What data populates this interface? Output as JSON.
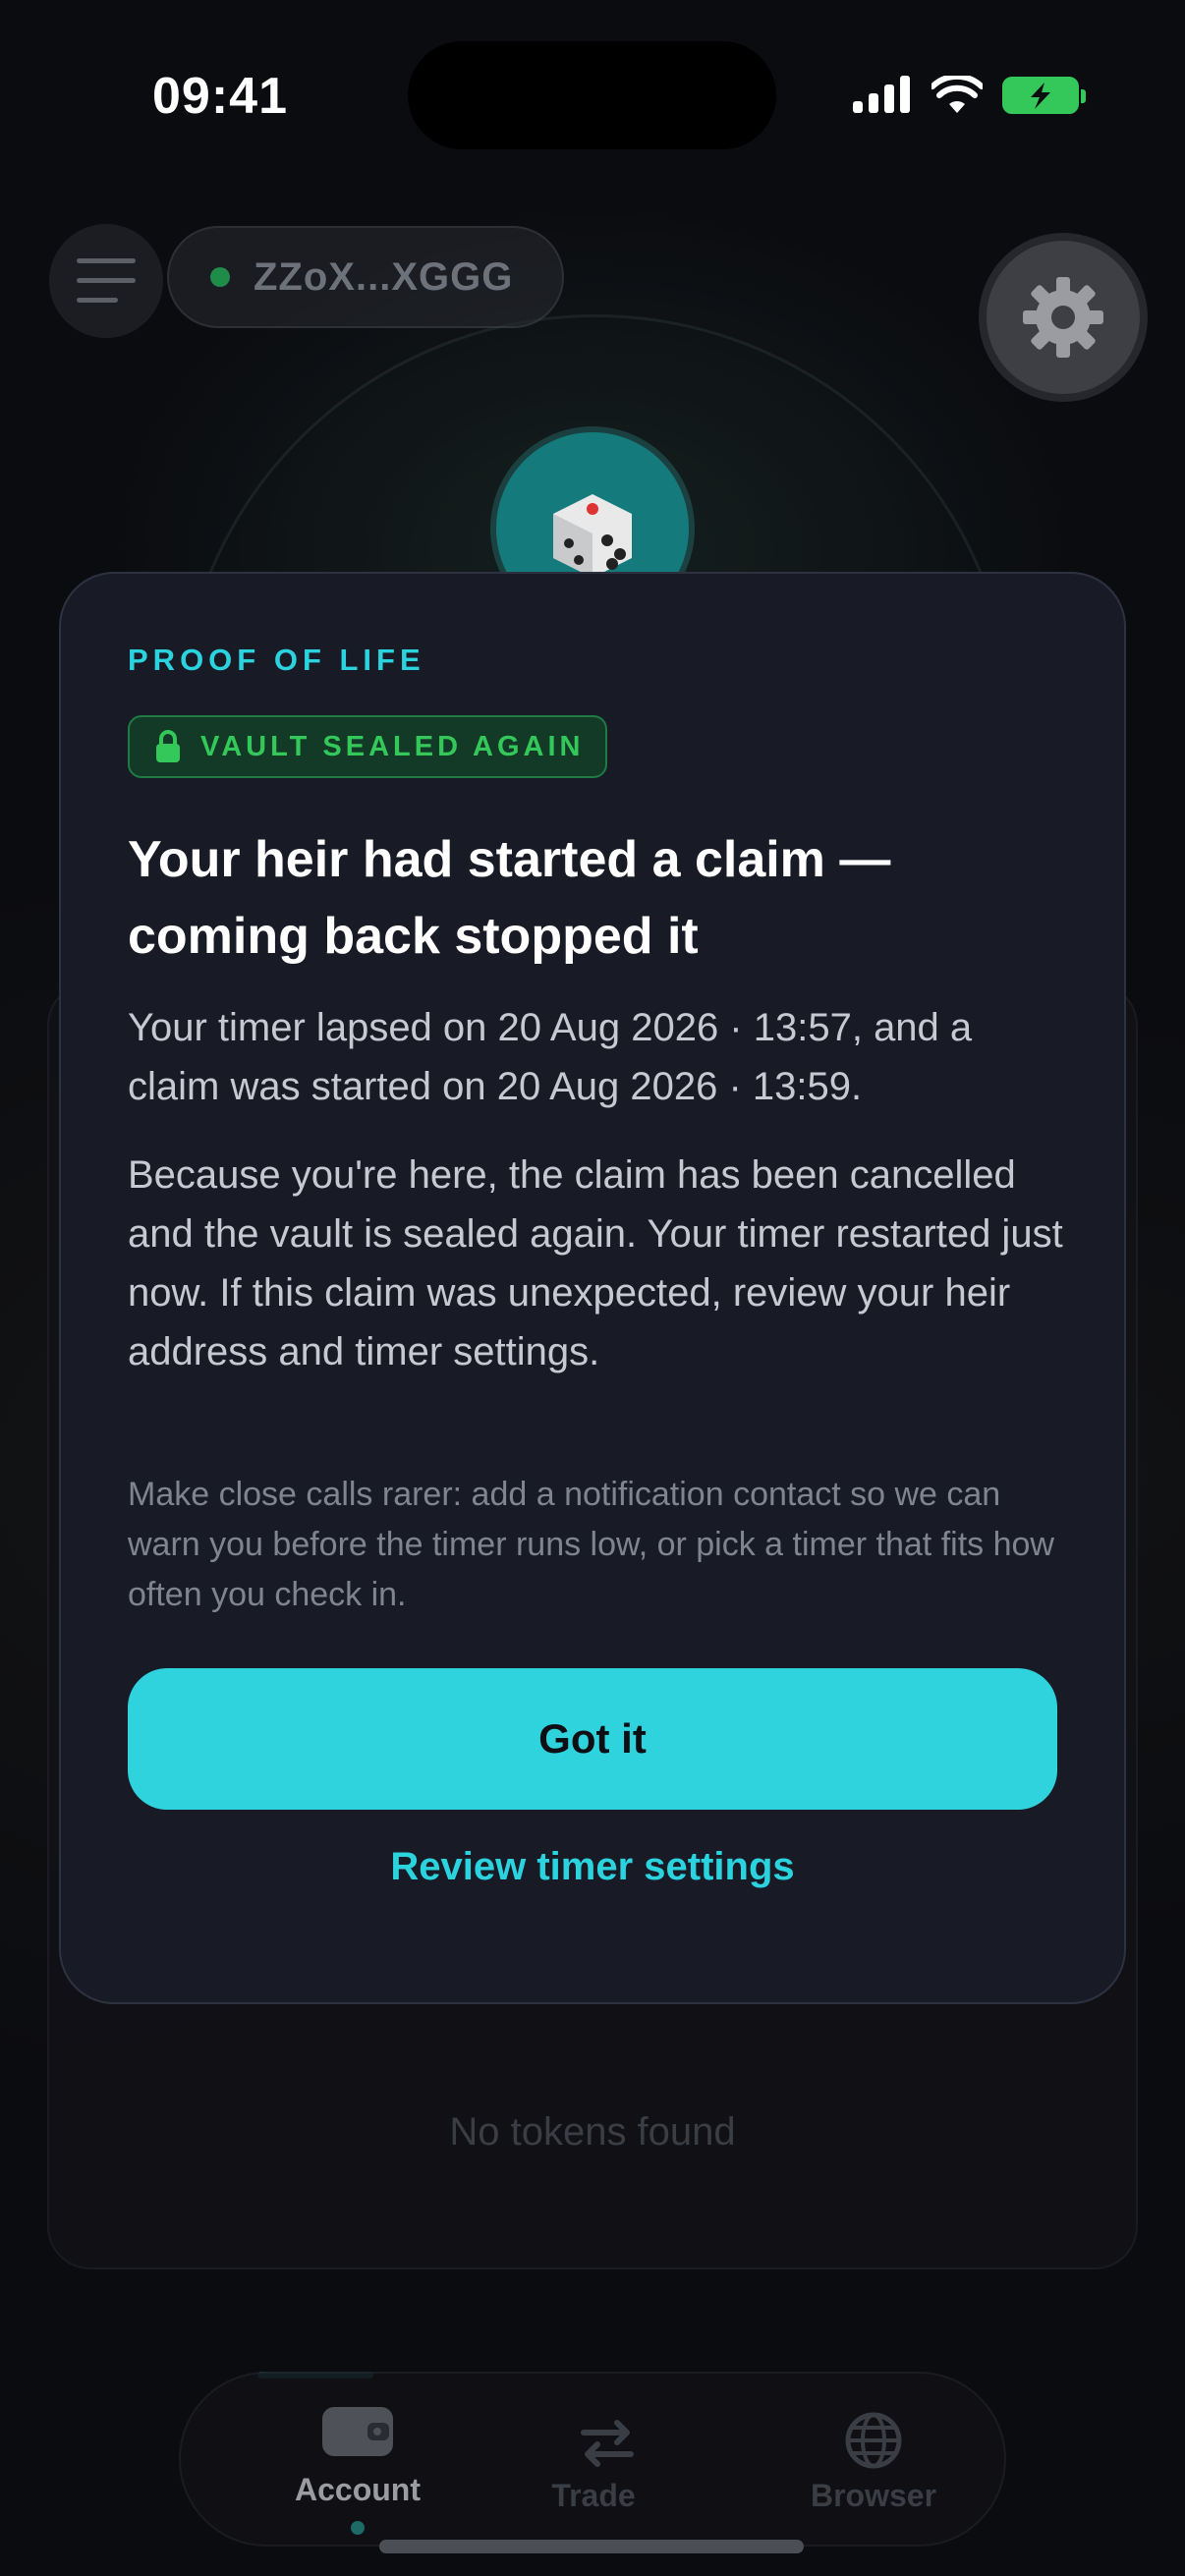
{
  "status_bar": {
    "time": "09:41"
  },
  "header": {
    "wallet_address": "ZZoX...XGGG"
  },
  "background": {
    "empty_state": "No tokens found"
  },
  "tabs": [
    {
      "label": "Account",
      "active": true,
      "icon": "wallet-icon"
    },
    {
      "label": "Trade",
      "active": false,
      "icon": "swap-arrows-icon"
    },
    {
      "label": "Browser",
      "active": false,
      "icon": "globe-icon"
    }
  ],
  "modal": {
    "eyebrow": "PROOF OF LIFE",
    "badge": "VAULT SEALED AGAIN",
    "title": "Your heir had started a claim — coming back stopped it",
    "body_1": "Your timer lapsed on 20 Aug 2026 · 13:57, and a claim was started on 20 Aug 2026 · 13:59.",
    "body_2": "Because you're here, the claim has been cancelled and the vault is sealed again. Your timer restarted just now. If this claim was unexpected, review your heir address and timer settings.",
    "hint": "Make close calls rarer: add a notification contact so we can warn you before the timer runs low, or pick a timer that fits how often you check in.",
    "primary_button": "Got it",
    "secondary_link": "Review timer settings"
  },
  "colors": {
    "accent": "#2fd3dd",
    "success": "#34c759",
    "modal_bg": "#181b26",
    "page_bg": "#0b0c10"
  }
}
